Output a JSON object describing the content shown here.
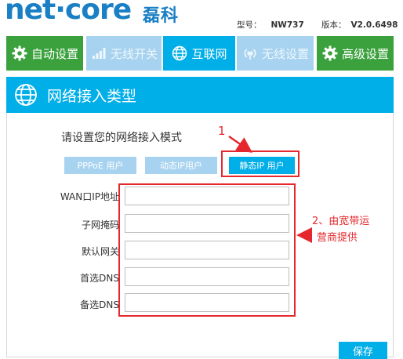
{
  "header": {
    "logo": "net·core",
    "logo_cn": "磊科",
    "model_label": "型号：",
    "model_value": "NW737",
    "version_label": "版本：",
    "version_value": "V2.0.6498"
  },
  "nav": {
    "tabs": [
      {
        "label": "自动设置",
        "icon": "gear-icon"
      },
      {
        "label": "无线开关",
        "icon": "signal-bars-icon"
      },
      {
        "label": "互联网",
        "icon": "globe-icon"
      },
      {
        "label": "无线设置",
        "icon": "wifi-icon"
      },
      {
        "label": "高级设置",
        "icon": "gear-icon"
      }
    ],
    "active_index": 2
  },
  "panel": {
    "title": "网络接入类型",
    "prompt": "请设置您的网络接入模式",
    "modes": [
      "PPPoE 用户",
      "动态IP用户",
      "静态IP 用户"
    ],
    "selected_mode": "静态IP 用户",
    "fields": [
      {
        "label": "WAN口IP地址",
        "value": ""
      },
      {
        "label": "子网掩码",
        "value": ""
      },
      {
        "label": "默认网关",
        "value": ""
      },
      {
        "label": "首选DNS",
        "value": ""
      },
      {
        "label": "备选DNS",
        "value": ""
      }
    ],
    "save_label": "保存"
  },
  "annotations": {
    "step1": "1",
    "step2_line1": "2、由宽带运",
    "step2_line2": "营商提供"
  },
  "colors": {
    "brand_blue": "#1a7fc4",
    "tab_green": "#3aa13c",
    "tab_active_blue": "#00aee8",
    "tab_inactive": "#a8d3f0",
    "annotation_red": "#e4282d"
  }
}
